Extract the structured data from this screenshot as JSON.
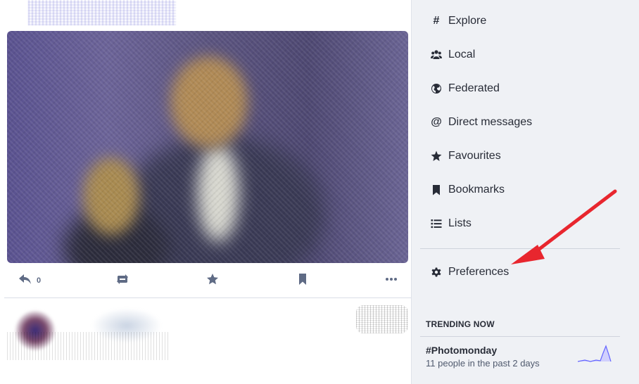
{
  "status": {
    "actions": {
      "reply_count": "0"
    }
  },
  "sidebar": {
    "items": [
      {
        "label": "Explore",
        "icon": "hashtag-icon"
      },
      {
        "label": "Local",
        "icon": "users-icon"
      },
      {
        "label": "Federated",
        "icon": "globe-icon"
      },
      {
        "label": "Direct messages",
        "icon": "at-icon"
      },
      {
        "label": "Favourites",
        "icon": "star-icon"
      },
      {
        "label": "Bookmarks",
        "icon": "bookmark-icon"
      },
      {
        "label": "Lists",
        "icon": "list-icon"
      },
      {
        "label": "Preferences",
        "icon": "gear-icon"
      }
    ]
  },
  "trending": {
    "heading": "TRENDING NOW",
    "items": [
      {
        "tag": "#Photomonday",
        "subtitle": "11 people in the past 2 days"
      }
    ]
  },
  "colors": {
    "sidebar_bg": "#eff1f5",
    "text": "#282c37",
    "muted": "#5f6b85",
    "annotation_arrow": "#e8262e",
    "sparkline": "#6364ff"
  }
}
